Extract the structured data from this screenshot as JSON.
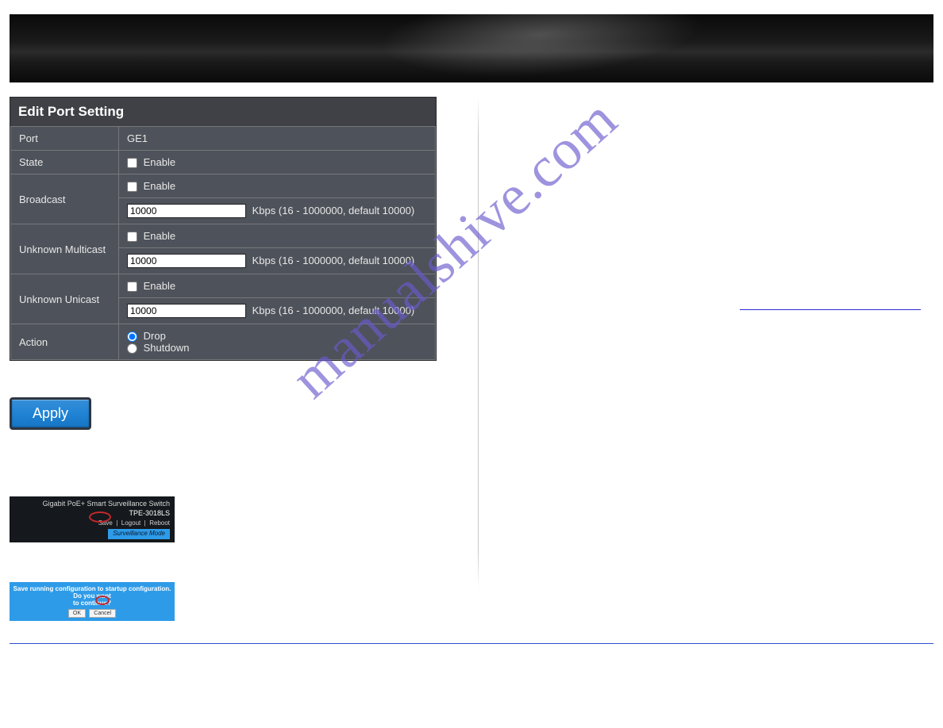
{
  "panel": {
    "title": "Edit Port Setting",
    "port_label": "Port",
    "port_value": "GE1",
    "state_label": "State",
    "enable_label": "Enable",
    "broadcast_label": "Broadcast",
    "broadcast_value": "10000",
    "kbps_hint": "Kbps (16 - 1000000, default 10000)",
    "unknown_multicast_label": "Unknown Multicast",
    "multicast_value": "10000",
    "unknown_unicast_label": "Unknown Unicast",
    "unicast_value": "10000",
    "action_label": "Action",
    "action_drop": "Drop",
    "action_shutdown": "Shutdown"
  },
  "apply_label": "Apply",
  "mini1": {
    "line1": "Gigabit PoE+ Smart Surveillance Switch",
    "model": "TPE-3018LS",
    "save": "Save",
    "logout": "Logout",
    "reboot": "Reboot",
    "surv": "Surveillance Mode"
  },
  "mini2": {
    "msg1": "Save running configuration to startup configuration. Do you want",
    "msg2": "to continue?",
    "ok": "OK",
    "cancel": "Cancel"
  },
  "watermark": "manualshive.com"
}
